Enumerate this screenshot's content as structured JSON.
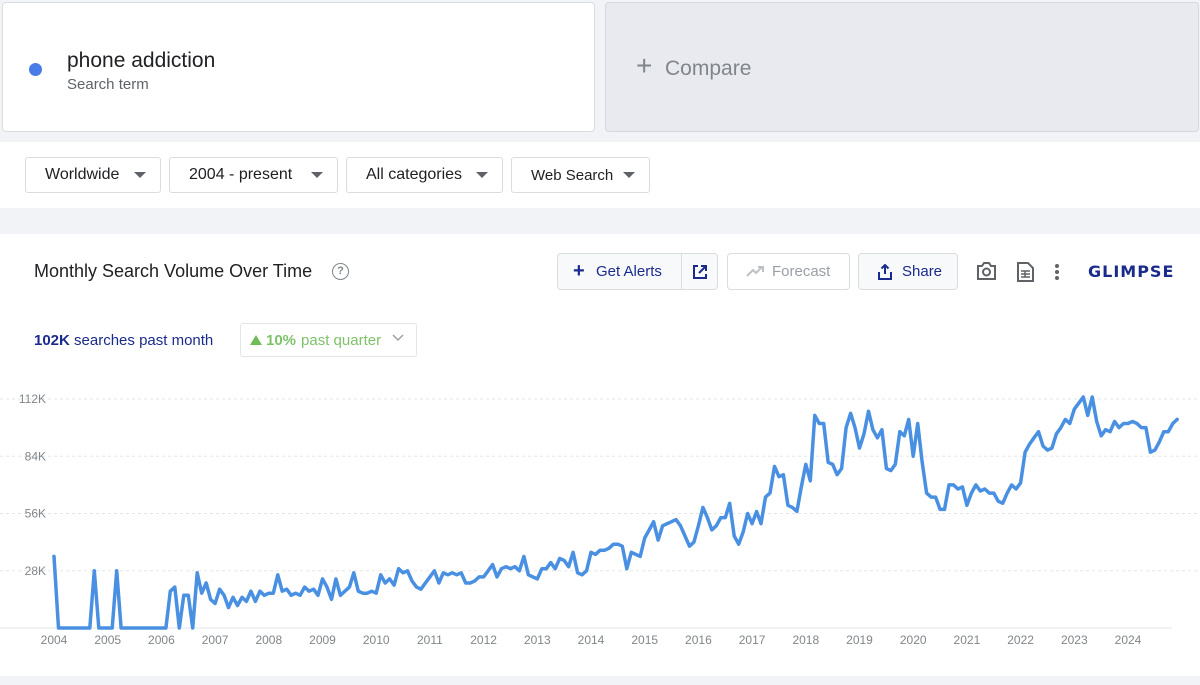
{
  "search_term": {
    "name": "phone addiction",
    "subtitle": "Search term",
    "color": "#4a7ce8"
  },
  "compare": {
    "plus": "+",
    "label": "Compare"
  },
  "filters": [
    {
      "label": "Worldwide"
    },
    {
      "label": "2004 - present"
    },
    {
      "label": "All categories"
    },
    {
      "label": "Web Search"
    }
  ],
  "chart_header": {
    "title": "Monthly Search Volume Over Time",
    "help": "?",
    "get_alerts": "Get Alerts",
    "forecast": "Forecast",
    "share": "Share",
    "logo": "GLIMPSE"
  },
  "stats": {
    "value": "102K",
    "value_suffix": "searches past month",
    "change": "10%",
    "change_suffix": "past quarter",
    "change_color": "#6fbd57"
  },
  "chart_data": {
    "type": "line",
    "title": "Monthly Search Volume Over Time",
    "xlabel": "",
    "ylabel": "",
    "y_ticks": [
      "28K",
      "56K",
      "84K",
      "112K"
    ],
    "y_tick_values": [
      28000,
      56000,
      84000,
      112000
    ],
    "x_ticks": [
      "2004",
      "2005",
      "2006",
      "2007",
      "2008",
      "2009",
      "2010",
      "2011",
      "2012",
      "2013",
      "2014",
      "2015",
      "2016",
      "2017",
      "2018",
      "2019",
      "2020",
      "2021",
      "2022",
      "2023",
      "2024"
    ],
    "ylim": [
      0,
      116000
    ],
    "grid": true,
    "line_color": "#4a90e2",
    "series": [
      {
        "points": [
          [
            "2004-01",
            35000
          ],
          [
            "2004-02",
            0
          ],
          [
            "2004-06",
            0
          ],
          [
            "2004-09",
            0
          ],
          [
            "2004-10",
            28000
          ],
          [
            "2004-11",
            0
          ],
          [
            "2005-02",
            0
          ],
          [
            "2005-03",
            28000
          ],
          [
            "2005-04",
            0
          ],
          [
            "2006-01",
            0
          ],
          [
            "2006-02",
            0
          ],
          [
            "2006-03",
            18000
          ],
          [
            "2006-04",
            20000
          ],
          [
            "2006-05",
            0
          ],
          [
            "2006-06",
            16000
          ],
          [
            "2006-07",
            16000
          ],
          [
            "2006-08",
            0
          ],
          [
            "2006-09",
            27000
          ],
          [
            "2006-10",
            17000
          ],
          [
            "2006-11",
            22000
          ],
          [
            "2006-12",
            14000
          ],
          [
            "2007-01",
            12000
          ],
          [
            "2007-02",
            19000
          ],
          [
            "2007-03",
            16000
          ],
          [
            "2007-04",
            10000
          ],
          [
            "2007-05",
            15000
          ],
          [
            "2007-06",
            11000
          ],
          [
            "2007-07",
            15000
          ],
          [
            "2007-08",
            13000
          ],
          [
            "2007-09",
            18000
          ],
          [
            "2007-10",
            13000
          ],
          [
            "2007-11",
            18000
          ],
          [
            "2007-12",
            16000
          ],
          [
            "2008-01",
            17000
          ],
          [
            "2008-02",
            17000
          ],
          [
            "2008-03",
            26000
          ],
          [
            "2008-04",
            18000
          ],
          [
            "2008-05",
            19000
          ],
          [
            "2008-06",
            16000
          ],
          [
            "2008-07",
            17000
          ],
          [
            "2008-08",
            16000
          ],
          [
            "2008-09",
            20000
          ],
          [
            "2008-10",
            18000
          ],
          [
            "2008-11",
            19000
          ],
          [
            "2008-12",
            16000
          ],
          [
            "2009-01",
            24000
          ],
          [
            "2009-02",
            20000
          ],
          [
            "2009-03",
            14000
          ],
          [
            "2009-04",
            24000
          ],
          [
            "2009-05",
            16000
          ],
          [
            "2009-06",
            18000
          ],
          [
            "2009-07",
            20000
          ],
          [
            "2009-08",
            27000
          ],
          [
            "2009-09",
            18000
          ],
          [
            "2009-10",
            17000
          ],
          [
            "2009-11",
            17000
          ],
          [
            "2009-12",
            18000
          ],
          [
            "2010-01",
            17000
          ],
          [
            "2010-02",
            26000
          ],
          [
            "2010-03",
            22000
          ],
          [
            "2010-04",
            24000
          ],
          [
            "2010-05",
            21000
          ],
          [
            "2010-06",
            29000
          ],
          [
            "2010-07",
            27000
          ],
          [
            "2010-08",
            28000
          ],
          [
            "2010-09",
            23000
          ],
          [
            "2010-10",
            20000
          ],
          [
            "2010-11",
            19000
          ],
          [
            "2010-12",
            22000
          ],
          [
            "2011-01",
            25000
          ],
          [
            "2011-02",
            28000
          ],
          [
            "2011-03",
            22000
          ],
          [
            "2011-04",
            27000
          ],
          [
            "2011-05",
            26000
          ],
          [
            "2011-06",
            27000
          ],
          [
            "2011-07",
            26000
          ],
          [
            "2011-08",
            27000
          ],
          [
            "2011-09",
            22000
          ],
          [
            "2011-10",
            22000
          ],
          [
            "2011-11",
            23000
          ],
          [
            "2011-12",
            25000
          ],
          [
            "2012-01",
            25000
          ],
          [
            "2012-02",
            28000
          ],
          [
            "2012-03",
            31000
          ],
          [
            "2012-04",
            25000
          ],
          [
            "2012-05",
            29000
          ],
          [
            "2012-06",
            30000
          ],
          [
            "2012-07",
            29000
          ],
          [
            "2012-08",
            30000
          ],
          [
            "2012-09",
            28000
          ],
          [
            "2012-10",
            35000
          ],
          [
            "2012-11",
            26000
          ],
          [
            "2012-12",
            25000
          ],
          [
            "2013-01",
            24000
          ],
          [
            "2013-02",
            29000
          ],
          [
            "2013-03",
            29000
          ],
          [
            "2013-04",
            32000
          ],
          [
            "2013-05",
            29000
          ],
          [
            "2013-06",
            34000
          ],
          [
            "2013-07",
            33000
          ],
          [
            "2013-08",
            30000
          ],
          [
            "2013-09",
            37000
          ],
          [
            "2013-10",
            27000
          ],
          [
            "2013-11",
            26000
          ],
          [
            "2013-12",
            28000
          ],
          [
            "2014-01",
            37000
          ],
          [
            "2014-02",
            36000
          ],
          [
            "2014-03",
            38000
          ],
          [
            "2014-04",
            38000
          ],
          [
            "2014-05",
            39000
          ],
          [
            "2014-06",
            41000
          ],
          [
            "2014-07",
            41000
          ],
          [
            "2014-08",
            40000
          ],
          [
            "2014-09",
            29000
          ],
          [
            "2014-10",
            37000
          ],
          [
            "2014-11",
            36000
          ],
          [
            "2014-12",
            35000
          ],
          [
            "2015-01",
            44000
          ],
          [
            "2015-02",
            48000
          ],
          [
            "2015-03",
            52000
          ],
          [
            "2015-04",
            43000
          ],
          [
            "2015-05",
            50000
          ],
          [
            "2015-06",
            51000
          ],
          [
            "2015-07",
            52000
          ],
          [
            "2015-08",
            53000
          ],
          [
            "2015-09",
            50000
          ],
          [
            "2015-10",
            45000
          ],
          [
            "2015-11",
            40000
          ],
          [
            "2015-12",
            42000
          ],
          [
            "2016-01",
            50000
          ],
          [
            "2016-02",
            59000
          ],
          [
            "2016-03",
            54000
          ],
          [
            "2016-04",
            48000
          ],
          [
            "2016-05",
            50000
          ],
          [
            "2016-06",
            54000
          ],
          [
            "2016-07",
            54000
          ],
          [
            "2016-08",
            61000
          ],
          [
            "2016-09",
            45000
          ],
          [
            "2016-10",
            41000
          ],
          [
            "2016-11",
            47000
          ],
          [
            "2016-12",
            56000
          ],
          [
            "2017-01",
            51000
          ],
          [
            "2017-02",
            57000
          ],
          [
            "2017-03",
            51000
          ],
          [
            "2017-04",
            64000
          ],
          [
            "2017-05",
            66000
          ],
          [
            "2017-06",
            79000
          ],
          [
            "2017-07",
            74000
          ],
          [
            "2017-08",
            75000
          ],
          [
            "2017-09",
            60000
          ],
          [
            "2017-10",
            59000
          ],
          [
            "2017-11",
            57000
          ],
          [
            "2017-12",
            69000
          ],
          [
            "2018-01",
            80000
          ],
          [
            "2018-02",
            72000
          ],
          [
            "2018-03",
            104000
          ],
          [
            "2018-04",
            100000
          ],
          [
            "2018-05",
            100000
          ],
          [
            "2018-06",
            81000
          ],
          [
            "2018-07",
            80000
          ],
          [
            "2018-08",
            75000
          ],
          [
            "2018-09",
            78000
          ],
          [
            "2018-10",
            98000
          ],
          [
            "2018-11",
            105000
          ],
          [
            "2018-12",
            98000
          ],
          [
            "2019-01",
            88000
          ],
          [
            "2019-02",
            95000
          ],
          [
            "2019-03",
            106000
          ],
          [
            "2019-04",
            97000
          ],
          [
            "2019-05",
            93000
          ],
          [
            "2019-06",
            97000
          ],
          [
            "2019-07",
            78000
          ],
          [
            "2019-08",
            77000
          ],
          [
            "2019-09",
            80000
          ],
          [
            "2019-10",
            96000
          ],
          [
            "2019-11",
            94000
          ],
          [
            "2019-12",
            102000
          ],
          [
            "2020-01",
            84000
          ],
          [
            "2020-02",
            100000
          ],
          [
            "2020-03",
            81000
          ],
          [
            "2020-04",
            66000
          ],
          [
            "2020-05",
            64000
          ],
          [
            "2020-06",
            64000
          ],
          [
            "2020-07",
            58000
          ],
          [
            "2020-08",
            58000
          ],
          [
            "2020-09",
            70000
          ],
          [
            "2020-10",
            70000
          ],
          [
            "2020-11",
            68000
          ],
          [
            "2020-12",
            69000
          ],
          [
            "2021-01",
            60000
          ],
          [
            "2021-02",
            66000
          ],
          [
            "2021-03",
            70000
          ],
          [
            "2021-04",
            67000
          ],
          [
            "2021-05",
            68000
          ],
          [
            "2021-06",
            66000
          ],
          [
            "2021-07",
            66000
          ],
          [
            "2021-08",
            62000
          ],
          [
            "2021-09",
            61000
          ],
          [
            "2021-10",
            66000
          ],
          [
            "2021-11",
            70000
          ],
          [
            "2021-12",
            68000
          ],
          [
            "2022-01",
            71000
          ],
          [
            "2022-02",
            86000
          ],
          [
            "2022-03",
            90000
          ],
          [
            "2022-04",
            93000
          ],
          [
            "2022-05",
            96000
          ],
          [
            "2022-06",
            89000
          ],
          [
            "2022-07",
            87000
          ],
          [
            "2022-08",
            88000
          ],
          [
            "2022-09",
            95000
          ],
          [
            "2022-10",
            98000
          ],
          [
            "2022-11",
            102000
          ],
          [
            "2022-12",
            100000
          ],
          [
            "2023-01",
            107000
          ],
          [
            "2023-02",
            110000
          ],
          [
            "2023-03",
            113000
          ],
          [
            "2023-04",
            104000
          ],
          [
            "2023-05",
            113000
          ],
          [
            "2023-06",
            101000
          ],
          [
            "2023-07",
            94000
          ],
          [
            "2023-08",
            97000
          ],
          [
            "2023-09",
            96000
          ],
          [
            "2023-10",
            101000
          ],
          [
            "2023-11",
            98000
          ],
          [
            "2023-12",
            100000
          ],
          [
            "2024-01",
            100000
          ],
          [
            "2024-02",
            101000
          ],
          [
            "2024-03",
            100000
          ],
          [
            "2024-04",
            98000
          ],
          [
            "2024-05",
            98000
          ],
          [
            "2024-06",
            86000
          ],
          [
            "2024-07",
            87000
          ],
          [
            "2024-08",
            91000
          ],
          [
            "2024-09",
            96000
          ],
          [
            "2024-10",
            96000
          ],
          [
            "2024-11",
            100000
          ],
          [
            "2024-12",
            102000
          ]
        ]
      }
    ]
  }
}
